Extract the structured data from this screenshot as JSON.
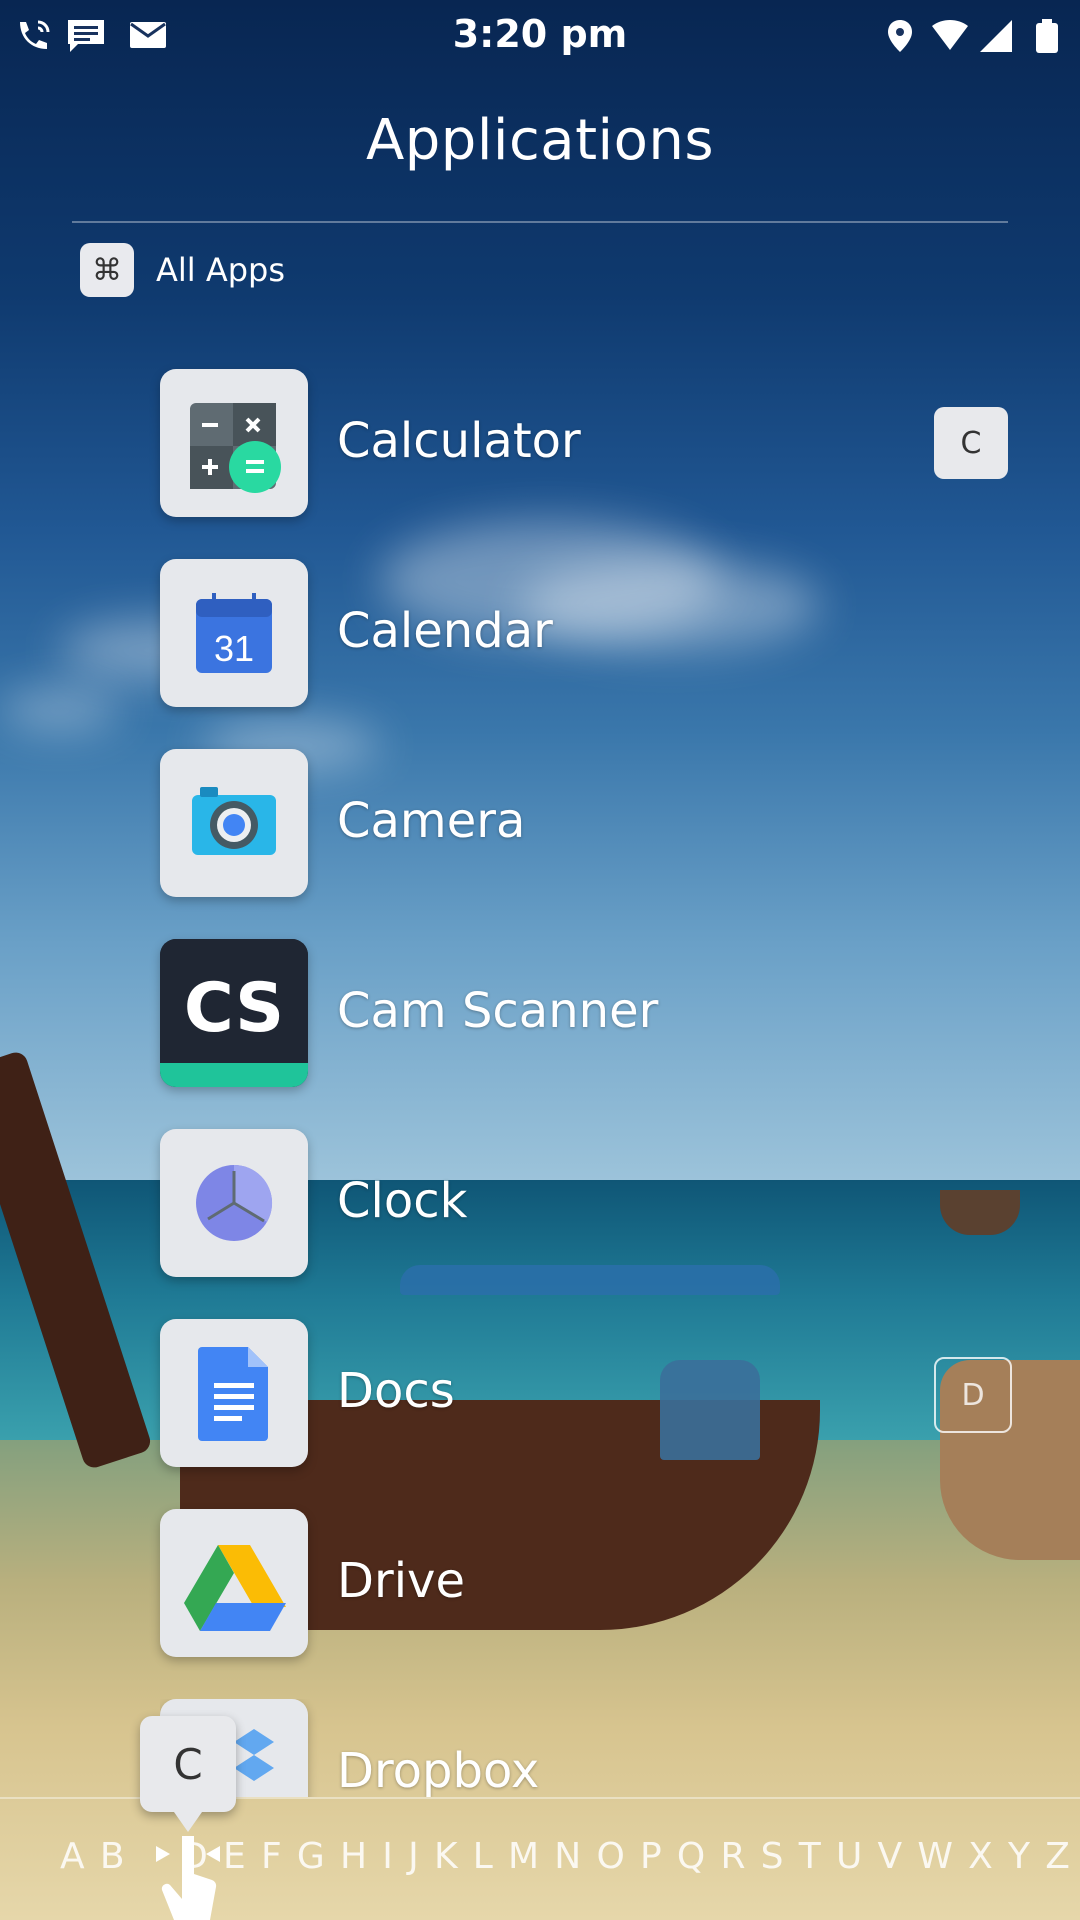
{
  "status_bar": {
    "time": "3:20 pm",
    "left_icons": [
      "phone-wifi-call-icon",
      "message-icon",
      "mail-icon"
    ],
    "right_icons": [
      "location-icon",
      "wifi-icon",
      "signal-icon",
      "battery-icon"
    ]
  },
  "header": {
    "title": "Applications"
  },
  "category": {
    "label": "All Apps",
    "icon": "command-icon"
  },
  "apps": [
    {
      "name": "Calculator",
      "icon": "calculator-icon"
    },
    {
      "name": "Calendar",
      "icon": "calendar-icon",
      "day": "31"
    },
    {
      "name": "Camera",
      "icon": "camera-icon"
    },
    {
      "name": "Cam Scanner",
      "icon": "camscanner-icon",
      "logo_text": "CS"
    },
    {
      "name": "Clock",
      "icon": "clock-icon"
    },
    {
      "name": "Docs",
      "icon": "docs-icon"
    },
    {
      "name": "Drive",
      "icon": "drive-icon"
    },
    {
      "name": "Dropbox",
      "icon": "dropbox-icon"
    }
  ],
  "section_markers": [
    {
      "letter": "C"
    },
    {
      "letter": "D"
    }
  ],
  "alphabet_bar": {
    "letters": [
      "A",
      "B",
      "C",
      "D",
      "E",
      "F",
      "G",
      "H",
      "I",
      "J",
      "K",
      "L",
      "M",
      "N",
      "O",
      "P",
      "Q",
      "R",
      "S",
      "T",
      "U",
      "V",
      "W",
      "X",
      "Y",
      "Z"
    ],
    "active_letter": "C"
  },
  "colors": {
    "accent_green": "#29d9a1",
    "calendar_blue": "#3b74e0",
    "camera_cyan": "#29b6e8",
    "camscanner_dark": "#1f2633",
    "camscanner_teal": "#1fc49a"
  }
}
